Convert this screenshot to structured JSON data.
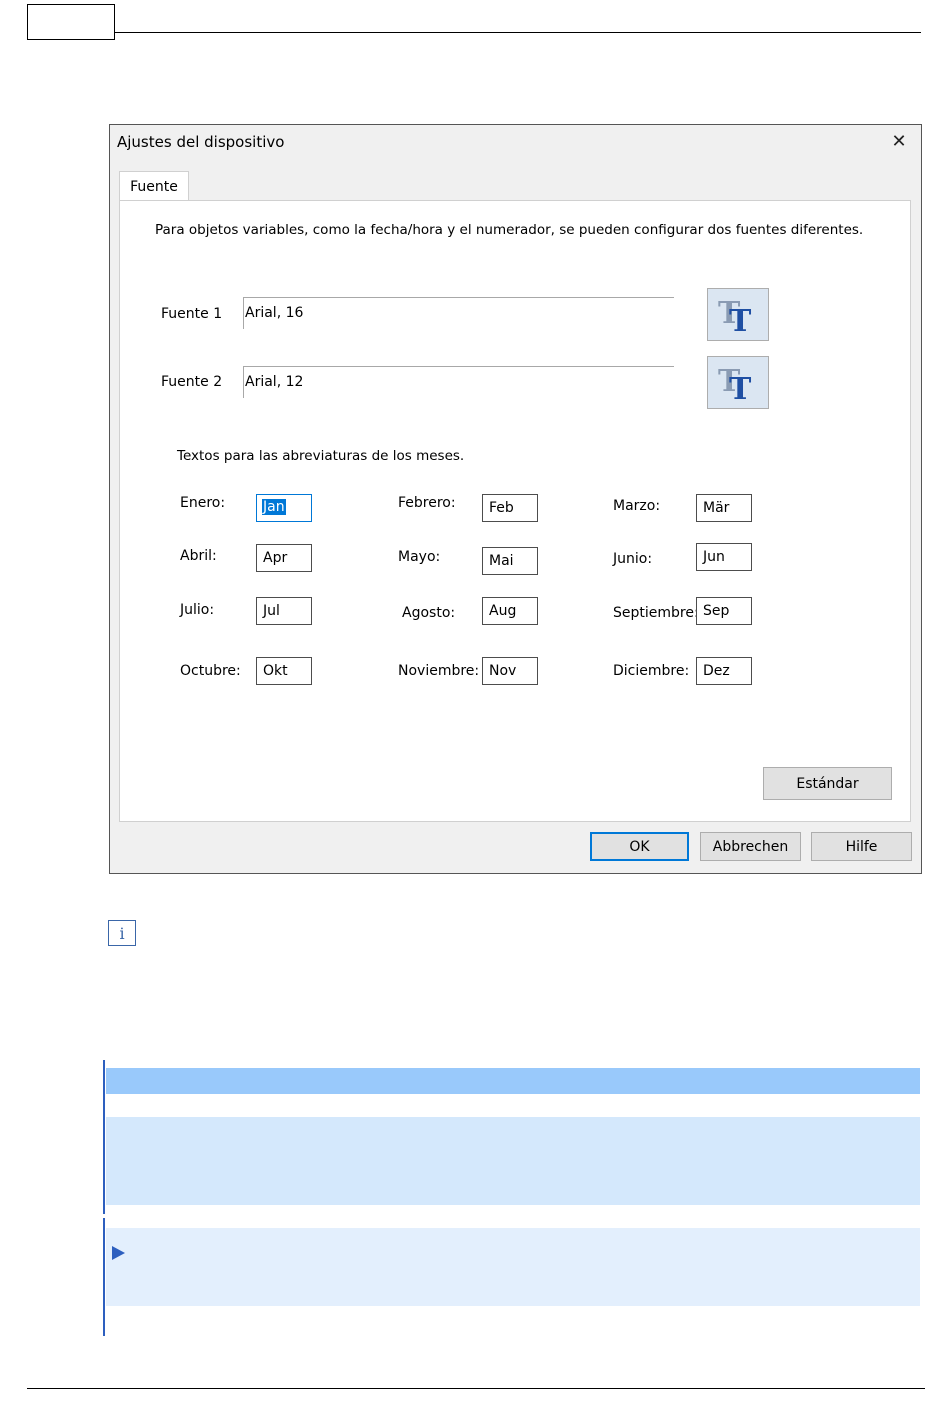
{
  "dialog": {
    "title": "Ajustes del dispositivo",
    "close_glyph": "✕",
    "tab_label": "Fuente",
    "description": "Para objetos variables, como la fecha/hora y el numerador, se pueden configurar dos fuentes diferentes.",
    "font1": {
      "label": "Fuente 1",
      "value": "Arial, 16"
    },
    "font2": {
      "label": "Fuente 2",
      "value": "Arial, 12"
    },
    "months_heading": "Textos para las abreviaturas de los meses.",
    "months": [
      {
        "label": "Enero:",
        "value": "Jan"
      },
      {
        "label": "Febrero:",
        "value": "Feb"
      },
      {
        "label": "Marzo:",
        "value": "Mär"
      },
      {
        "label": "Abril:",
        "value": "Apr"
      },
      {
        "label": "Mayo:",
        "value": "Mai"
      },
      {
        "label": "Junio:",
        "value": "Jun"
      },
      {
        "label": "Julio:",
        "value": "Jul"
      },
      {
        "label": "Agosto:",
        "value": "Aug"
      },
      {
        "label": "Septiembre:",
        "value": "Sep"
      },
      {
        "label": "Octubre:",
        "value": "Okt"
      },
      {
        "label": "Noviembre:",
        "value": "Nov"
      },
      {
        "label": "Diciembre:",
        "value": "Dez"
      }
    ],
    "standard_button": "Estándar",
    "ok_button": "OK",
    "cancel_button": "Abbrechen",
    "help_button": "Hilfe"
  },
  "info_icon_glyph": "i",
  "colors": {
    "accent": "#0078d7",
    "band_dark": "#99c9fb",
    "band_mid": "#d4e8fc",
    "band_light": "#e3effd",
    "rule_blue": "#2d5fbf"
  }
}
